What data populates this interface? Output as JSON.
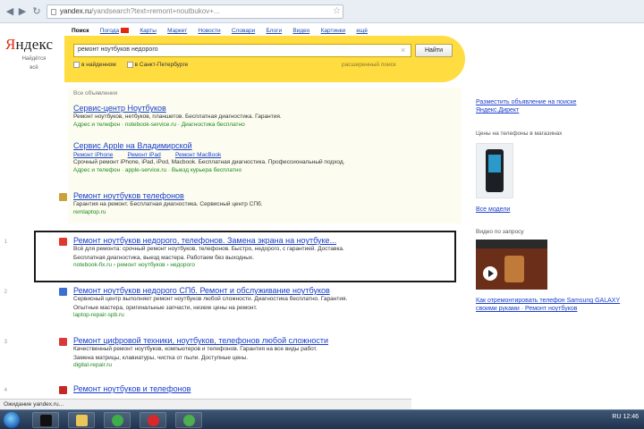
{
  "browser": {
    "url_domain": "yandex.ru",
    "url_path": "/yandsearch?text=remont+noutbukov+..."
  },
  "logo": {
    "name_red": "Я",
    "name_rest": "ндекс",
    "sub1": "Найдётся",
    "sub2": "всё"
  },
  "services": [
    {
      "label": "Поиск",
      "current": true
    },
    {
      "label": "Погода",
      "hot": true
    },
    {
      "label": "Карты"
    },
    {
      "label": "Маркет"
    },
    {
      "label": "Новости"
    },
    {
      "label": "Словари"
    },
    {
      "label": "Блоги"
    },
    {
      "label": "Видео"
    },
    {
      "label": "Картинки"
    },
    {
      "label": "ещё"
    }
  ],
  "search": {
    "query": "ремонт ноутбуков недорого",
    "button": "Найти",
    "clear": "×",
    "option1": "в найденном",
    "option2": "в Санкт-Петербурге",
    "advanced": "расширенный поиск"
  },
  "ads": {
    "header": "Все объявления",
    "items": [
      {
        "title": "Сервис-центр Ноутбуков",
        "snippet": "Ремонт ноутбуков, нетбуков, планшетов. Бесплатная диагностика. Гарантия.",
        "url": "Адрес и телефон · notebook-service.ru · Диагностика бесплатно"
      },
      {
        "title": "Сервис Apple на Владимирской",
        "sitelinks": [
          "Ремонт iPhone",
          "Ремонт iPad",
          "Ремонт MacBook"
        ],
        "snippet": "Срочный ремонт iPhone, iPad, iPod, Macbook. Бесплатная диагностика. Профессиональный подход.",
        "url": "Адрес и телефон · apple-service.ru · Выезд курьера бесплатно"
      },
      {
        "title": "Ремонт ноутбуков телефонов",
        "snippet": "Гарантия на ремонт. Бесплатная диагностика. Сервисный центр СПб.",
        "url": "remlaptop.ru"
      }
    ]
  },
  "results": [
    {
      "num": "1",
      "title": "Ремонт ноутбуков недорого, телефонов. Замена экрана на ноутбуке...",
      "snippet1": "Всё для ремонта: срочный ремонт ноутбуков, телефонов. Быстро, недорого, с гарантией. Доставка.",
      "snippet2": "Бесплатная диагностика, выезд мастера. Работаем без выходных.",
      "url": "notebook-fix.ru › ремонт ноутбуков › недорого",
      "fav_color": "#e0392b"
    },
    {
      "num": "2",
      "title": "Ремонт ноутбуков недорого СПб. Ремонт и обслуживание ноутбуков",
      "snippet1": "Сервисный центр выполняет ремонт ноутбуков любой сложности. Диагностика бесплатно. Гарантия.",
      "snippet2": "Опытные мастера, оригинальные запчасти, низкие цены на ремонт.",
      "url": "laptop-repair-spb.ru",
      "fav_color": "#3b6fd6"
    },
    {
      "num": "3",
      "title": "Ремонт цифровой техники, ноутбуков, телефонов любой сложности",
      "snippet1": "Качественный ремонт ноутбуков, компьютеров и телефонов. Гарантия на все виды работ.",
      "snippet2": "Замена матрицы, клавиатуры, чистка от пыли. Доступные цены.",
      "url": "digital-repair.ru",
      "fav_color": "#d83a3a"
    },
    {
      "num": "4",
      "title": "Ремонт ноутбуков и телефонов",
      "snippet1": "",
      "snippet2": "",
      "url": "",
      "fav_color": "#c62828"
    }
  ],
  "right": {
    "ad_link1": "Разместить объявление на поиске",
    "ad_link2": "Яндекс.Директ",
    "market_head": "Цены на телефоны в магазинах",
    "phone_link": "Все модели",
    "video_head": "Видео по запросу",
    "video_caption1": "Как отремонтировать телефон Samsung GALAXY",
    "video_caption2": "своими руками · Ремонт ноутбуков"
  },
  "status": "Ожидание yandex.ru...",
  "tray": "RU  12:46"
}
